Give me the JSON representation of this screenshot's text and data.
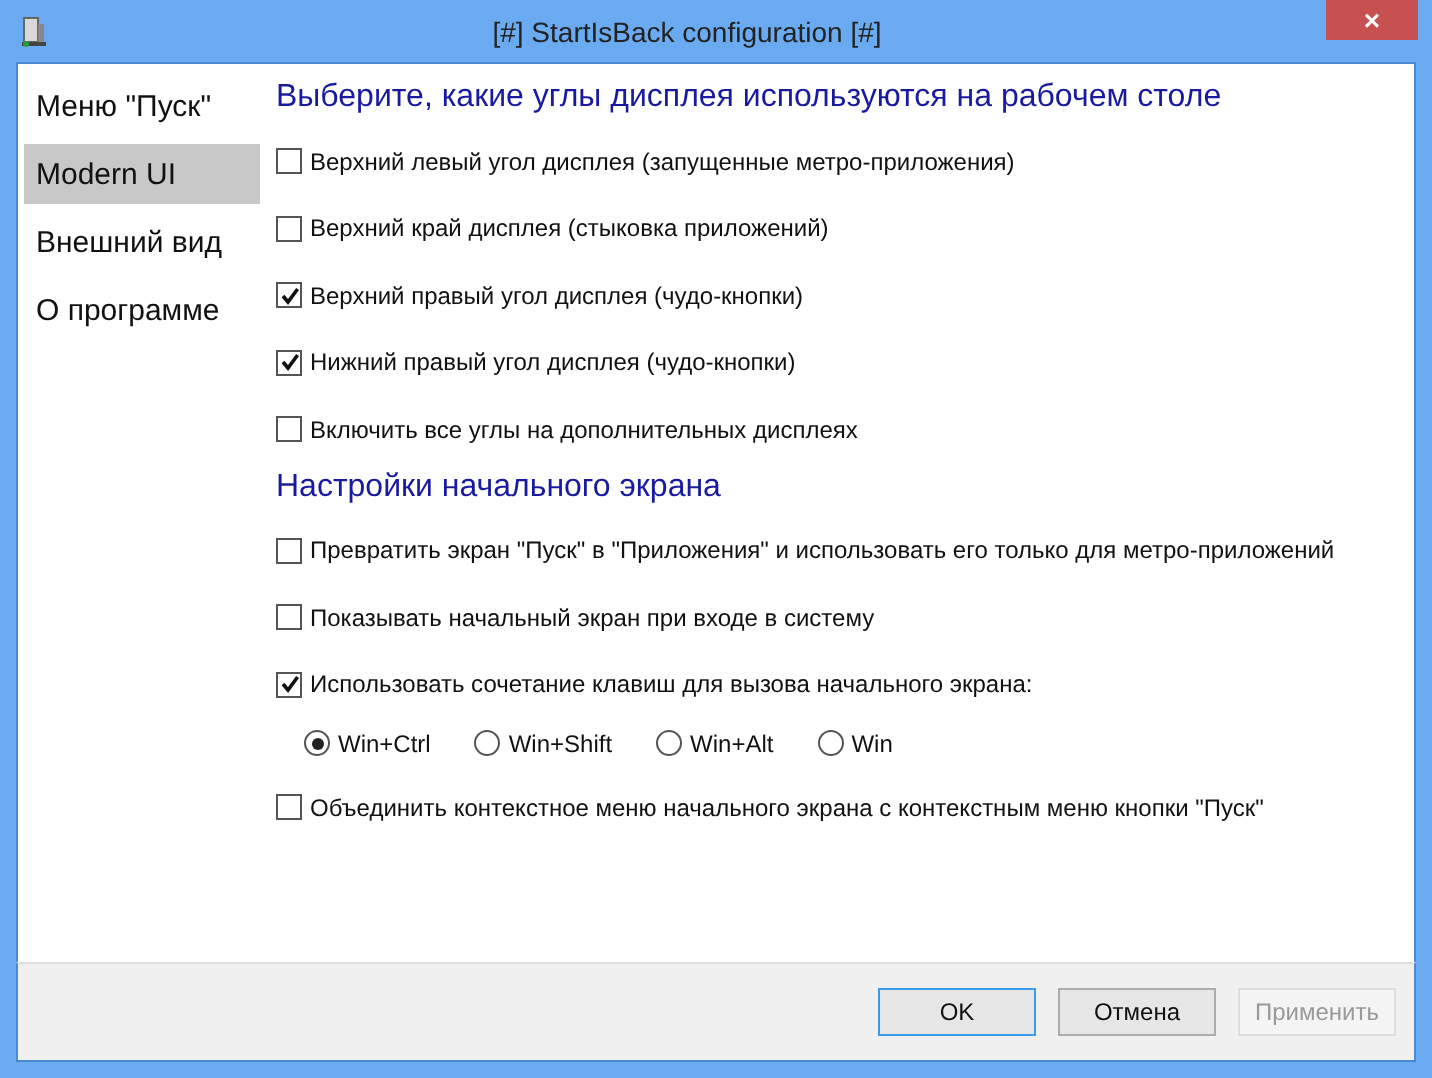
{
  "window": {
    "title": "[#] StartIsBack configuration [#]",
    "close": "×"
  },
  "sidebar": {
    "items": [
      {
        "label": "Меню \"Пуск\"",
        "selected": false
      },
      {
        "label": "Modern UI",
        "selected": true
      },
      {
        "label": "Внешний вид",
        "selected": false
      },
      {
        "label": "О программе",
        "selected": false
      }
    ]
  },
  "sections": [
    {
      "heading": "Выберите, какие углы дисплея используются на рабочем столе",
      "options": [
        {
          "kind": "checkbox",
          "label": "Верхний левый угол дисплея (запущенные метро-приложения)",
          "checked": false
        },
        {
          "kind": "checkbox",
          "label": "Верхний край дисплея (стыковка приложений)",
          "checked": false
        },
        {
          "kind": "checkbox",
          "label": "Верхний правый угол дисплея (чудо-кнопки)",
          "checked": true
        },
        {
          "kind": "checkbox",
          "label": "Нижний правый угол дисплея (чудо-кнопки)",
          "checked": true
        },
        {
          "kind": "checkbox",
          "label": "Включить все углы на дополнительных дисплеях",
          "checked": false
        }
      ]
    },
    {
      "heading": "Настройки начального экрана",
      "options": [
        {
          "kind": "checkbox",
          "label": "Превратить экран \"Пуск\" в \"Приложения\" и использовать его только для метро-приложений",
          "checked": false
        },
        {
          "kind": "checkbox",
          "label": "Показывать начальный экран при входе в систему",
          "checked": false
        },
        {
          "kind": "checkbox",
          "label": "Использовать сочетание клавиш для вызова начального экрана:",
          "checked": true
        },
        {
          "kind": "radios",
          "items": [
            {
              "label": "Win+Ctrl",
              "selected": true
            },
            {
              "label": "Win+Shift",
              "selected": false
            },
            {
              "label": "Win+Alt",
              "selected": false
            },
            {
              "label": "Win",
              "selected": false
            }
          ]
        },
        {
          "kind": "checkbox",
          "label": "Объединить контекстное меню начального экрана с контекстным меню кнопки \"Пуск\"",
          "checked": false
        }
      ]
    }
  ],
  "buttons": [
    {
      "label": "OK",
      "default": true,
      "disabled": false
    },
    {
      "label": "Отмена",
      "default": false,
      "disabled": false
    },
    {
      "label": "Применить",
      "default": false,
      "disabled": true
    }
  ]
}
